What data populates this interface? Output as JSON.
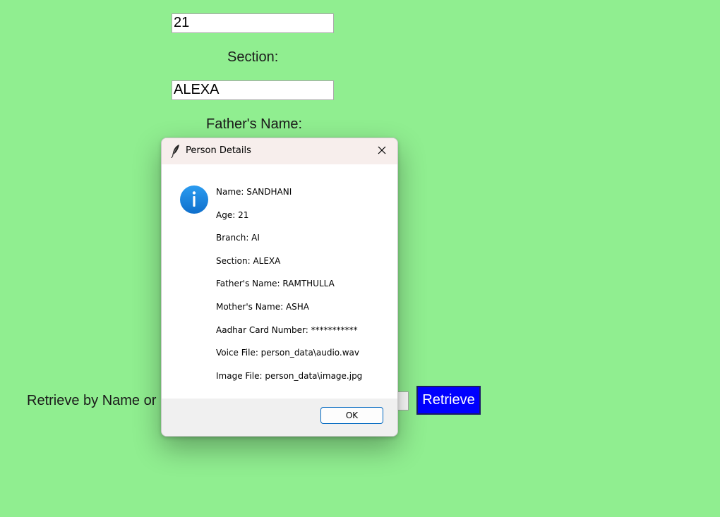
{
  "form": {
    "age_value": "21",
    "section_label": "Section:",
    "section_value": "ALEXA",
    "father_label": "Father's Name:",
    "retrieve_label": "Retrieve by Name or R",
    "retrieve_button": "Retrieve"
  },
  "dialog": {
    "title": "Person Details",
    "title_icon": "feather-icon",
    "close_icon": "close-icon",
    "info_icon": "info-icon",
    "lines": [
      "Name: SANDHANI",
      "Age: 21",
      "Branch: AI",
      "Section: ALEXA",
      "Father's Name: RAMTHULLA",
      "Mother's Name: ASHA",
      "Aadhar Card Number: ***********",
      "Voice File: person_data\\audio.wav",
      "Image File: person_data\\image.jpg"
    ],
    "ok_label": "OK"
  },
  "colors": {
    "background": "#90ee90",
    "retrieve_button": "#0000ff",
    "info_icon": "#1a86e0",
    "titlebar": "#f7eeec"
  }
}
